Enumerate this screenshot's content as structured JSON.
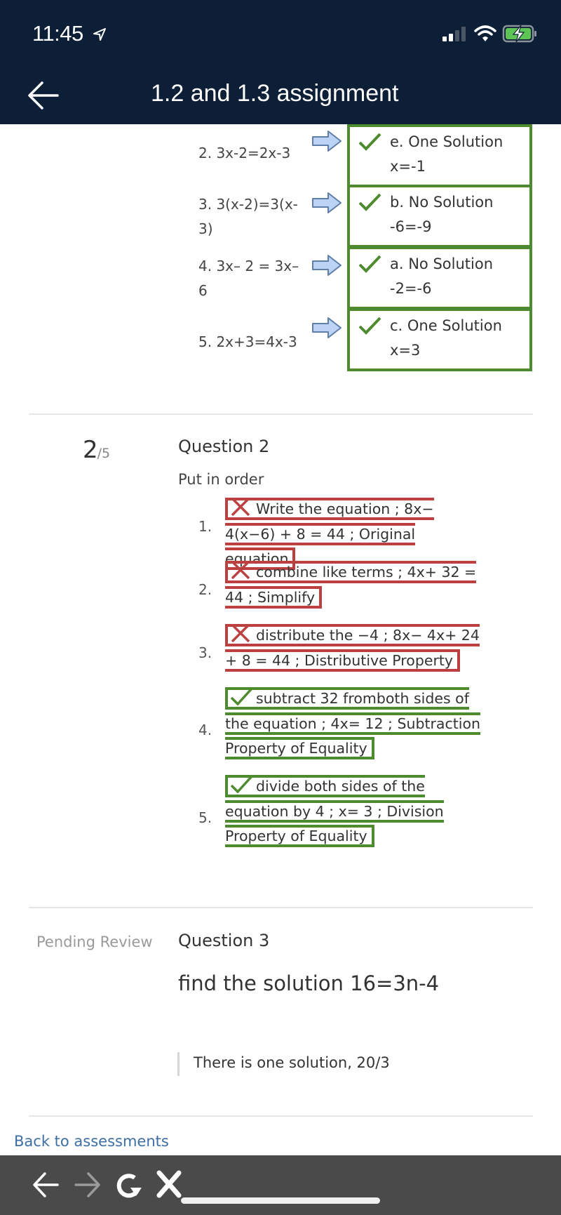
{
  "status_bar": {
    "time": "11:45"
  },
  "header": {
    "title": "1.2 and 1.3 assignment"
  },
  "colors": {
    "header_bg": "#0d1f36",
    "correct": "#4e8a2e",
    "incorrect": "#bd4040",
    "link": "#3d6fa6",
    "arrow_fill": "#bcd3f5"
  },
  "question1": {
    "matches": [
      {
        "prompt": "2. 3x-2=2x-3",
        "answer_line1": "e. One Solution",
        "answer_line2": "x=-1",
        "status": "correct"
      },
      {
        "prompt": "3. 3(x-2)=3(x-3)",
        "answer_line1": "b. No Solution",
        "answer_line2": "-6=-9",
        "status": "correct"
      },
      {
        "prompt": "4. 3x– 2 = 3x–6",
        "answer_line1": "a. No Solution",
        "answer_line2": "-2=-6",
        "status": "correct"
      },
      {
        "prompt": "5. 2x+3=4x-3",
        "answer_line1": "c. One Solution",
        "answer_line2": "x=3",
        "status": "correct"
      }
    ]
  },
  "question2": {
    "score": "2",
    "score_total": "/5",
    "title": "Question 2",
    "instruction": "Put in order",
    "items": [
      {
        "number": "1.",
        "text": "Write the equation ; 8x− 4(x−6) + 8 = 44 ; Original equation",
        "status": "incorrect"
      },
      {
        "number": "2.",
        "text": "combine like terms ; 4x+ 32 = 44 ; Simplify",
        "status": "incorrect"
      },
      {
        "number": "3.",
        "text": "distribute the −4 ; 8x− 4x+ 24 + 8 = 44 ; Distributive Property",
        "status": "incorrect"
      },
      {
        "number": "4.",
        "text": "subtract 32 fromboth sides of the equation ; 4x= 12 ; Subtraction Property of Equality",
        "status": "correct"
      },
      {
        "number": "5.",
        "text": "divide both sides of the equation by 4 ; x= 3 ; Division Property of Equality",
        "status": "correct"
      }
    ]
  },
  "question3": {
    "status": "Pending Review",
    "title": "Question 3",
    "prompt": "find the solution 16=3n-4",
    "answer": "There is one solution, 20/3"
  },
  "footer": {
    "back_link": "Back to assessments"
  },
  "toolbar": {
    "icons": [
      "back-arrow-icon",
      "forward-arrow-icon",
      "reload-icon",
      "close-icon"
    ]
  }
}
